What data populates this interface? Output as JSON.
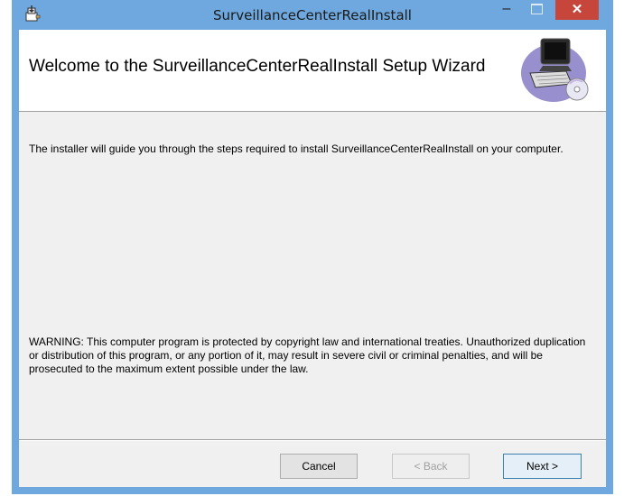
{
  "window": {
    "title": "SurveillanceCenterRealInstall"
  },
  "banner": {
    "title": "Welcome to the SurveillanceCenterRealInstall Setup Wizard",
    "art_icon": "computer-disc-icon"
  },
  "content": {
    "intro": "The installer will guide you through the steps required to install SurveillanceCenterRealInstall on your computer.",
    "warning": "WARNING: This computer program is protected by copyright law and international treaties. Unauthorized duplication or distribution of this program, or any portion of it, may result in severe civil or criminal penalties, and will be prosecuted to the maximum extent possible under the law."
  },
  "buttons": {
    "cancel": "Cancel",
    "back": "< Back",
    "next": "Next >"
  },
  "controls": {
    "minimize": "–",
    "close": "✕"
  },
  "colors": {
    "titlebar": "#6fa8de",
    "close": "#c7463c",
    "client": "#f0f0f0"
  }
}
